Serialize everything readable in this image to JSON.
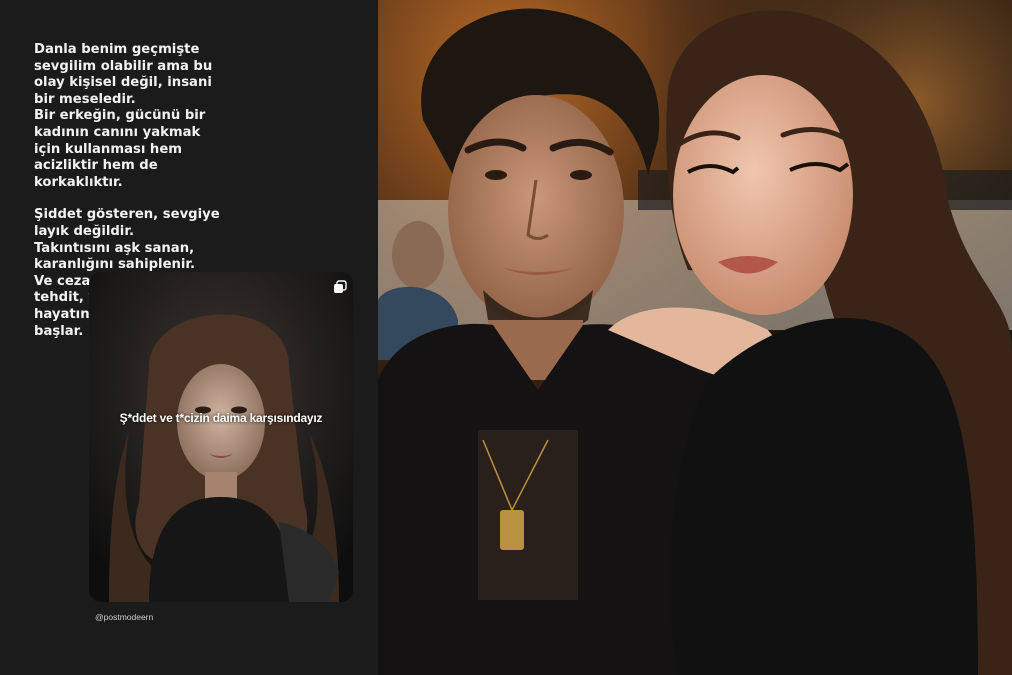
{
  "story": {
    "paragraphs": [
      "Danla benim geçmişte\nsevgilim olabilir ama bu\nolay kişisel değil, insani\nbir meseledir.\nBir erkeğin, gücünü bir\nkadının canını yakmak\niçin kullanması hem\nacizliktir hem de\nkorkaklıktır.",
      "Şiddet gösteren, sevgiye\nlayık değildir.\nTakıntısını aşk sanan,\nkaranlığını sahiplenir.\nVe cezasız kalan her\ntehdit, yeni bir kadının\nhayatına mezar kazmaya\nbaşlar."
    ],
    "repost": {
      "caption": "Ş*ddet ve t*cizin daima karşısındayız",
      "icon": "multiple-posts-icon"
    },
    "handle": "@postmodeern"
  },
  "colors": {
    "panel_bg": "#1b1b1b",
    "text": "#f2f2f2"
  }
}
